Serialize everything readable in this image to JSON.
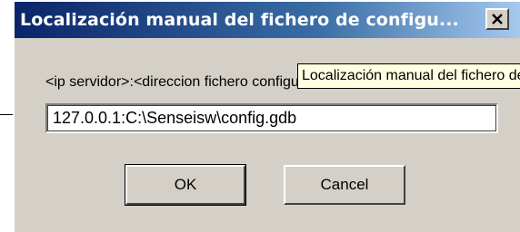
{
  "dialog": {
    "title": "Localización manual del fichero de configu...",
    "close_icon": "close-icon",
    "path_label": "<ip servidor>:<direccion fichero configu",
    "tooltip_text": "Localización manual del fichero de configuración",
    "path_value": "127.0.0.1:C:\\Senseisw\\config.gdb",
    "ok_label": "OK",
    "cancel_label": "Cancel"
  },
  "colors": {
    "titlebar_start": "#0a246a",
    "titlebar_end": "#a6caf0",
    "face": "#d4d0c8",
    "tooltip_bg": "#ffffe1"
  }
}
